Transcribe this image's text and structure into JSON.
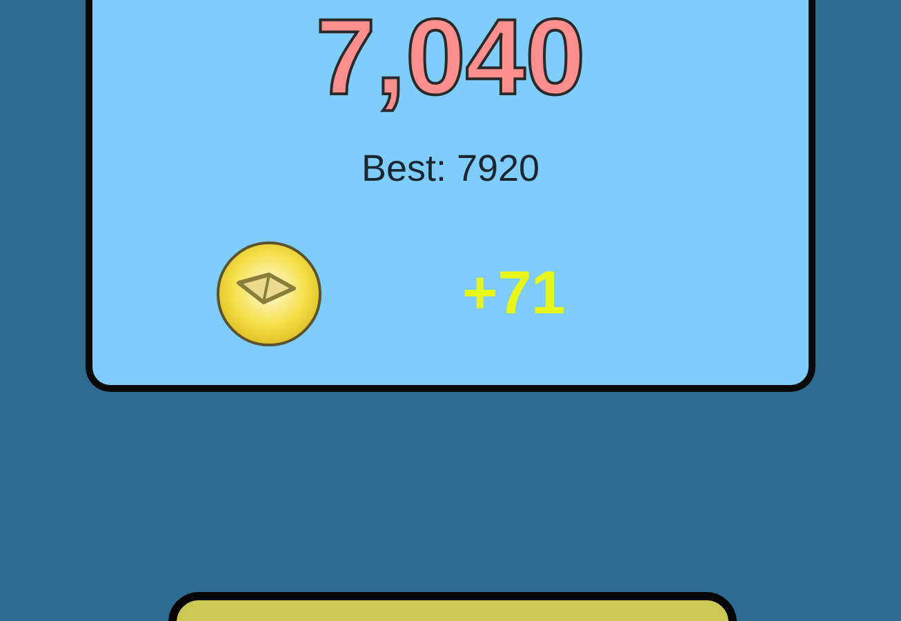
{
  "score": "7,040",
  "best": "Best: 7920",
  "coin_reward": "+71"
}
